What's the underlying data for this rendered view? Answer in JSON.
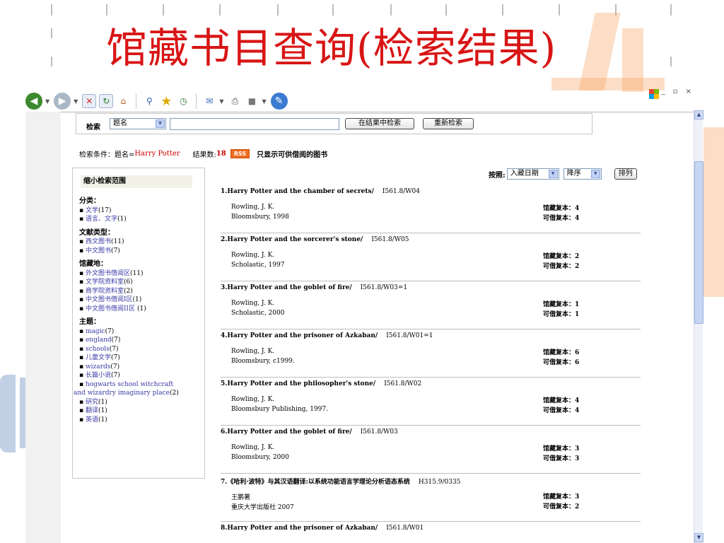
{
  "slide": {
    "title": "馆藏书目查询(检索结果)"
  },
  "colors": {
    "title_red": "#d81515",
    "accent_orange": "#f6a15b",
    "link_blue": "#3a3aa8",
    "count_red": "#cc0000"
  },
  "toolbar": {
    "icons": [
      "back-icon",
      "forward-icon",
      "stop-icon",
      "refresh-icon",
      "home-icon",
      "search-icon",
      "favorites-icon",
      "history-icon",
      "mail-icon",
      "print-icon",
      "edit-icon",
      "messenger-icon"
    ],
    "window_controls": "_ ▫ ×"
  },
  "search": {
    "label": "检索",
    "field": "题名",
    "query": "",
    "search_within_label": "在结果中检索",
    "new_search_label": "重新检索"
  },
  "criteria": {
    "prefix": "检索条件：题名=",
    "term": "Harry Potter",
    "count_label": "结果数:",
    "count": "18",
    "rss": "RSS",
    "available_only": "只显示可供借阅的图书"
  },
  "sidebar": {
    "heading": "缩小检索范围",
    "groups": [
      {
        "title": "分类：",
        "items": [
          {
            "label": "文学",
            "count": "(17)"
          },
          {
            "label": "语言、文字",
            "count": "(1)"
          }
        ]
      },
      {
        "title": "文献类型：",
        "items": [
          {
            "label": "西文图书",
            "count": "(11)"
          },
          {
            "label": "中文图书",
            "count": "(7)"
          }
        ]
      },
      {
        "title": "馆藏地：",
        "items": [
          {
            "label": "外文图书借阅区",
            "count": "(11)"
          },
          {
            "label": "文学院资料室",
            "count": "(6)"
          },
          {
            "label": "商学院资料室",
            "count": "(2)"
          },
          {
            "label": "中文图书借阅I区",
            "count": "(1)"
          },
          {
            "label": "中文图书借阅II区 ",
            "count": "(1)"
          }
        ]
      },
      {
        "title": "主题：",
        "items": [
          {
            "label": "magic",
            "count": "(7)"
          },
          {
            "label": "england",
            "count": "(7)"
          },
          {
            "label": "schools",
            "count": "(7)"
          },
          {
            "label": "儿童文学",
            "count": "(7)"
          },
          {
            "label": "wizards",
            "count": "(7)"
          },
          {
            "label": "长篇小说",
            "count": "(7)"
          },
          {
            "label": "hogwarts school witchcraft",
            "label2": "and wizardry imaginary place",
            "count": "(2)"
          },
          {
            "label": "研究",
            "count": "(1)"
          },
          {
            "label": "翻译",
            "count": "(1)"
          },
          {
            "label": "英语",
            "count": "(1)"
          }
        ]
      }
    ]
  },
  "sort": {
    "by_label": "按照:",
    "field": "入藏日期",
    "order": "降序",
    "button": "排列"
  },
  "results": [
    {
      "title": "1.Harry Potter and the chamber of secrets/",
      "call": "I561.8/W04",
      "author": "Rowling, J. K.",
      "publisher": "Bloomsbury, 1998",
      "copies": "馆藏复本：4",
      "available": "可借复本：4"
    },
    {
      "title": "2.Harry Potter and the sorcerer's stone/",
      "call": "I561.8/W05",
      "author": "Rowling, J. K.",
      "publisher": "Scholastic, 1997",
      "copies": "馆藏复本：2",
      "available": "可借复本：2"
    },
    {
      "title": "3.Harry Potter and the goblet of fire/",
      "call": "I561.8/W03=1",
      "author": "Rowling, J. K.",
      "publisher": "Scholastic, 2000",
      "copies": "馆藏复本：1",
      "available": "可借复本：1"
    },
    {
      "title": "4.Harry Potter and the prisoner of Azkaban/",
      "call": "I561.8/W01=1",
      "author": "Rowling, J. K.",
      "publisher": "Bloomsbury, c1999.",
      "copies": "馆藏复本：6",
      "available": "可借复本：6"
    },
    {
      "title": "5.Harry Potter and the philosopher's stone/",
      "call": "I561.8/W02",
      "author": "Rowling, J. K.",
      "publisher": "Bloomsbury Publishing, 1997.",
      "copies": "馆藏复本：4",
      "available": "可借复本：4"
    },
    {
      "title": "6.Harry Potter and the goblet of fire/",
      "call": "I561.8/W03",
      "author": "Rowling, J. K.",
      "publisher": "Bloomsbury, 2000",
      "copies": "馆藏复本：3",
      "available": "可借复本：3"
    },
    {
      "title": "7.《哈利·波特》与其汉语翻译:以系统功能语言学理论分析语态系统",
      "call": "H315.9/0335",
      "author": "王鹏著",
      "publisher": "重庆大学出版社 2007",
      "copies": "馆藏复本：3",
      "available": "可借复本：2"
    },
    {
      "title": "8.Harry Potter and the prisoner of Azkaban/",
      "call": "I561.8/W01",
      "author": "",
      "publisher": "",
      "copies": "",
      "available": ""
    }
  ]
}
